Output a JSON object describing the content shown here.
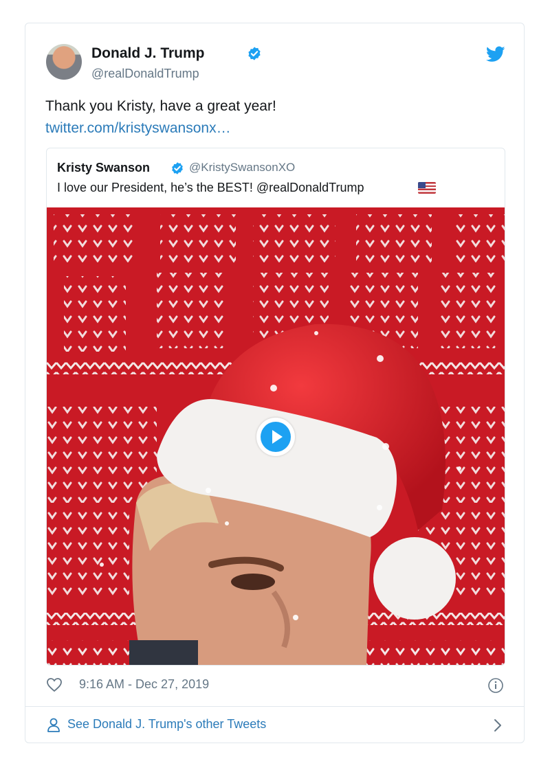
{
  "author": {
    "name": "Donald J. Trump",
    "handle": "@realDonaldTrump"
  },
  "tweet": {
    "text": "Thank you Kristy, have a great year!",
    "link": "twitter.com/kristyswansonx…"
  },
  "quoted_tweet": {
    "name": "Kristy Swanson",
    "handle": "@KristySwansonXO",
    "text": "I love our President, he’s the BEST! @realDonaldTrump",
    "emoji": "flag-us"
  },
  "meta": {
    "timestamp": "9:16 AM - Dec 27, 2019"
  },
  "footer": {
    "other_tweets_label": "See Donald J. Trump's other Tweets"
  },
  "icons": {
    "verified": "verified-badge-icon",
    "brand": "twitter-bird-icon",
    "like": "heart-icon",
    "info": "info-icon",
    "profile": "person-icon",
    "more": "chevron-right-icon",
    "play": "play-icon"
  },
  "colors": {
    "twitter_blue": "#1da1f2",
    "link": "#2b7bb9",
    "secondary_text": "#657786",
    "border": "#e1e8ed",
    "sweater_red": "#c91a25",
    "santa_hat_red": "#d9242c"
  }
}
